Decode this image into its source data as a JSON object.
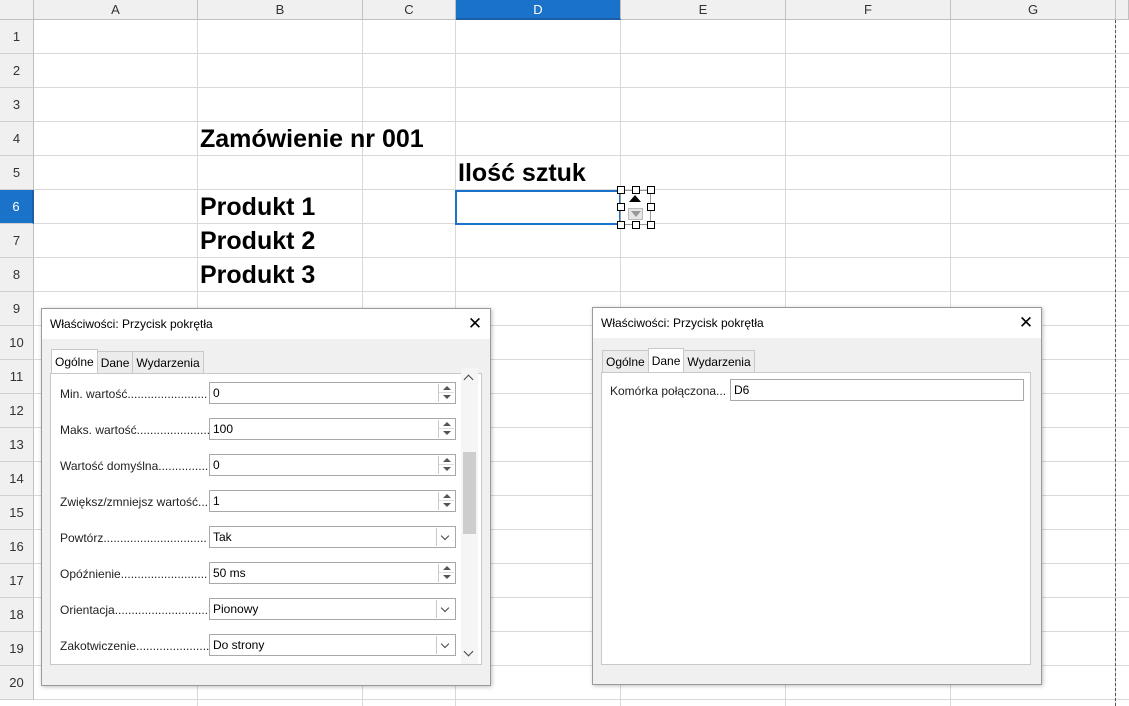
{
  "spreadsheet": {
    "columns": [
      "A",
      "B",
      "C",
      "D",
      "E",
      "F",
      "G"
    ],
    "selected_column": "D",
    "rows": [
      "1",
      "2",
      "3",
      "4",
      "5",
      "6",
      "7",
      "8",
      "9",
      "10",
      "11",
      "12",
      "13",
      "14",
      "15",
      "16",
      "17",
      "18",
      "19",
      "20"
    ],
    "selected_row": "6",
    "cells": {
      "B4": "Zamówienie nr 001",
      "D5": "Ilość sztuk",
      "B6": "Produkt 1",
      "B7": "Produkt 2",
      "B8": "Produkt 3"
    },
    "active_cell": "D6",
    "accent_color": "#1a73c8"
  },
  "dialog_general": {
    "title": "Właściwości: Przycisk pokrętła",
    "tabs": [
      "Ogólne",
      "Dane",
      "Wydarzenia"
    ],
    "active_tab": "Ogólne",
    "properties": [
      {
        "label": "Min. wartość........................",
        "value": "0",
        "type": "spin"
      },
      {
        "label": "Maks. wartość......................",
        "value": "100",
        "type": "spin"
      },
      {
        "label": "Wartość domyślna...............",
        "value": "0",
        "type": "spin"
      },
      {
        "label": "Zwiększ/zmniejsz wartość...",
        "value": "1",
        "type": "spin"
      },
      {
        "label": "Powtórz...............................",
        "value": "Tak",
        "type": "dropdown"
      },
      {
        "label": "Opóźnienie..........................",
        "value": "50 ms",
        "type": "spin"
      },
      {
        "label": "Orientacja............................",
        "value": "Pionowy",
        "type": "dropdown"
      },
      {
        "label": "Zakotwiczenie......................",
        "value": "Do strony",
        "type": "dropdown"
      }
    ]
  },
  "dialog_data": {
    "title": "Właściwości: Przycisk pokrętła",
    "tabs": [
      "Ogólne",
      "Dane",
      "Wydarzenia"
    ],
    "active_tab": "Dane",
    "linked_cell_label": "Komórka połączona...",
    "linked_cell_value": "D6"
  },
  "icons": {
    "close": "close-icon",
    "spin_up": "chevron-up-icon",
    "spin_down": "chevron-down-icon"
  }
}
